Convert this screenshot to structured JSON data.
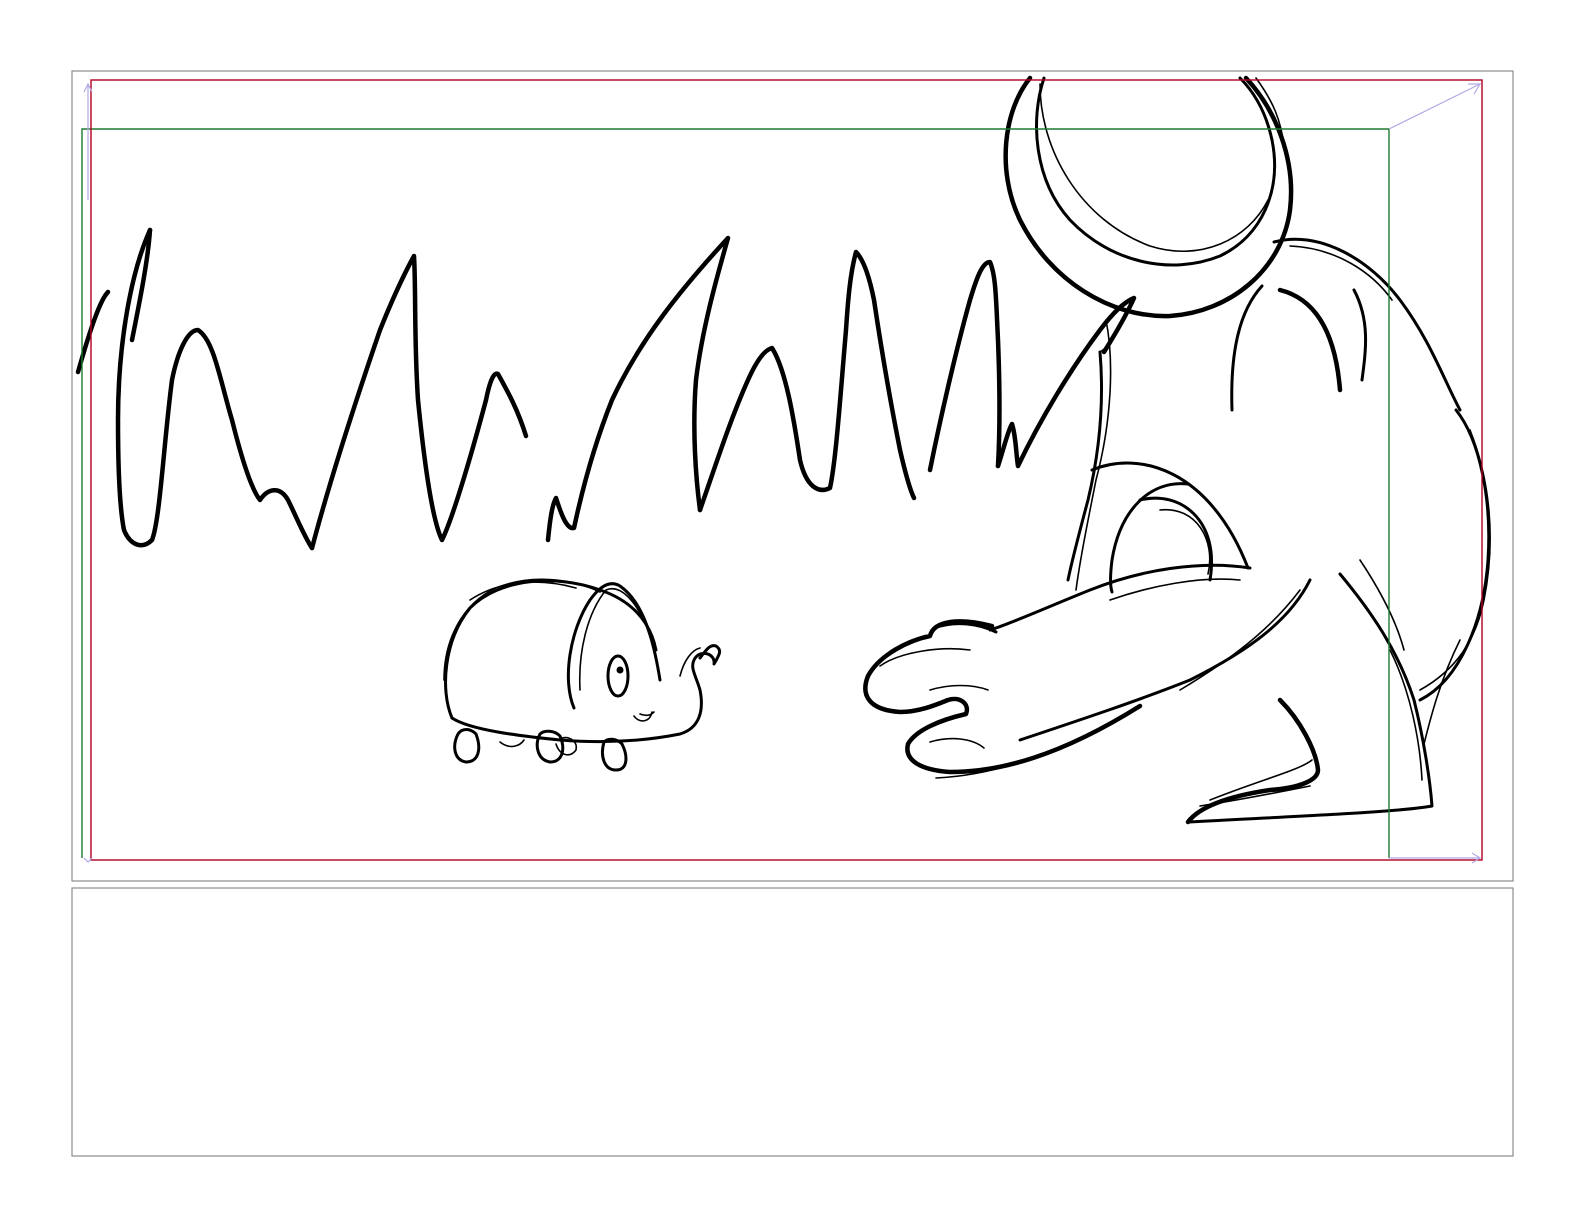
{
  "storyboard": {
    "panels": [
      {
        "id": "panel-1",
        "content": "sketch"
      },
      {
        "id": "panel-2",
        "content": "empty"
      }
    ]
  },
  "colors": {
    "panel_border": "#8c8c8c",
    "safe_action": "#b00020",
    "safe_title": "#1e7a2e",
    "camera_move": "#b4a8e6",
    "ink": "#000000"
  },
  "icons": {
    "camera_move_arrow": "arrow-icon"
  }
}
